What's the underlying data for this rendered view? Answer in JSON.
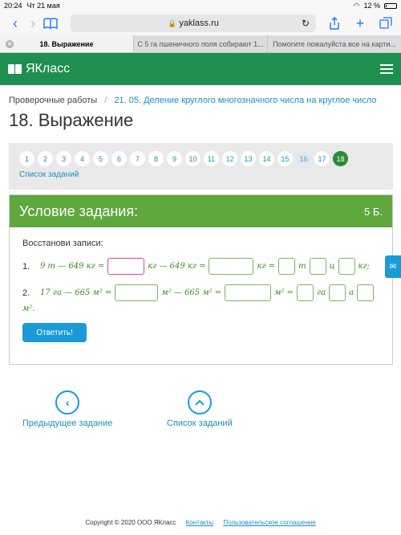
{
  "status": {
    "time": "20:24",
    "date": "Чт 21 мая",
    "battery": "12 %",
    "battery_level": 0.12
  },
  "browser": {
    "url": "yaklass.ru"
  },
  "tabs": [
    {
      "label": "18. Выражение"
    },
    {
      "label": "С 5 га пшеничного поля собирают 1..."
    },
    {
      "label": "Помогите пожалуйста все на карти..."
    }
  ],
  "site": {
    "logo": "ЯКласс"
  },
  "breadcrumb": {
    "root": "Проверочные работы",
    "current": "21. 05. Деление круглого многозначного числа на круглое число"
  },
  "page_title": "18. Выражение",
  "pagination": {
    "pages": [
      "1",
      "2",
      "3",
      "4",
      "5",
      "6",
      "7",
      "8",
      "9",
      "10",
      "11",
      "12",
      "13",
      "14",
      "15",
      "16",
      "17",
      "18"
    ],
    "muted_pages": [
      "16"
    ],
    "current": "18",
    "tasks_link": "Список заданий"
  },
  "task": {
    "header": "Условие задания:",
    "points": "5 Б.",
    "prompt": "Восстанови записи:",
    "line1": {
      "num": "1.",
      "expr": "9 т — 649 кг =",
      "u1": "кг — 649 кг =",
      "u2": "кг =",
      "u3": "т",
      "u4": "ц",
      "u5": "кг;"
    },
    "line2": {
      "num": "2.",
      "expr": "17 га — 665 м² =",
      "u1": "м² — 665 м² =",
      "u2": "м² =",
      "u3": "га",
      "u4": "а",
      "u5": "м²."
    },
    "submit": "Ответить!"
  },
  "nav": {
    "prev": "Предыдущее задание",
    "list": "Список заданий"
  },
  "footer": {
    "copyright": "Copyright © 2020 ООО ЯКласс",
    "contacts": "Контакты",
    "agreement": "Пользовательское соглашение"
  }
}
